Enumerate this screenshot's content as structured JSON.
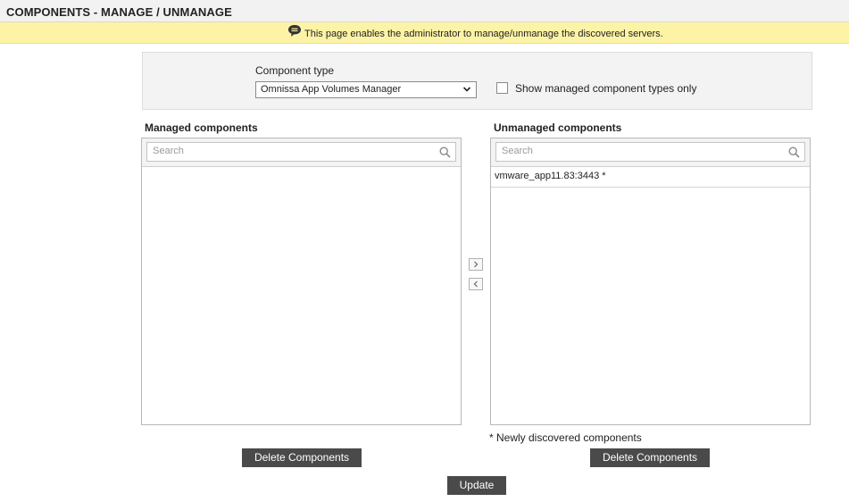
{
  "header": {
    "title": "COMPONENTS - MANAGE / UNMANAGE"
  },
  "notice": {
    "icon": "speech-bubble-icon",
    "text": "This page enables the administrator to manage/unmanage the discovered servers."
  },
  "filter": {
    "component_type_label": "Component type",
    "component_type_value": "Omnissa App Volumes Manager",
    "show_managed_only_label": "Show managed component types only",
    "show_managed_only_checked": false
  },
  "managed": {
    "title": "Managed components",
    "search_placeholder": "Search",
    "items": []
  },
  "unmanaged": {
    "title": "Unmanaged components",
    "search_placeholder": "Search",
    "items": [
      "vmware_app11.83:3443 *"
    ],
    "note": "* Newly discovered components"
  },
  "actions": {
    "delete_managed_label": "Delete Components",
    "delete_unmanaged_label": "Delete Components",
    "update_label": "Update",
    "move_right_icon": "chevron-right-icon",
    "move_left_icon": "chevron-left-icon"
  },
  "colors": {
    "notice_bg": "#fdf3a6",
    "button_bg": "#4a4a4a"
  }
}
